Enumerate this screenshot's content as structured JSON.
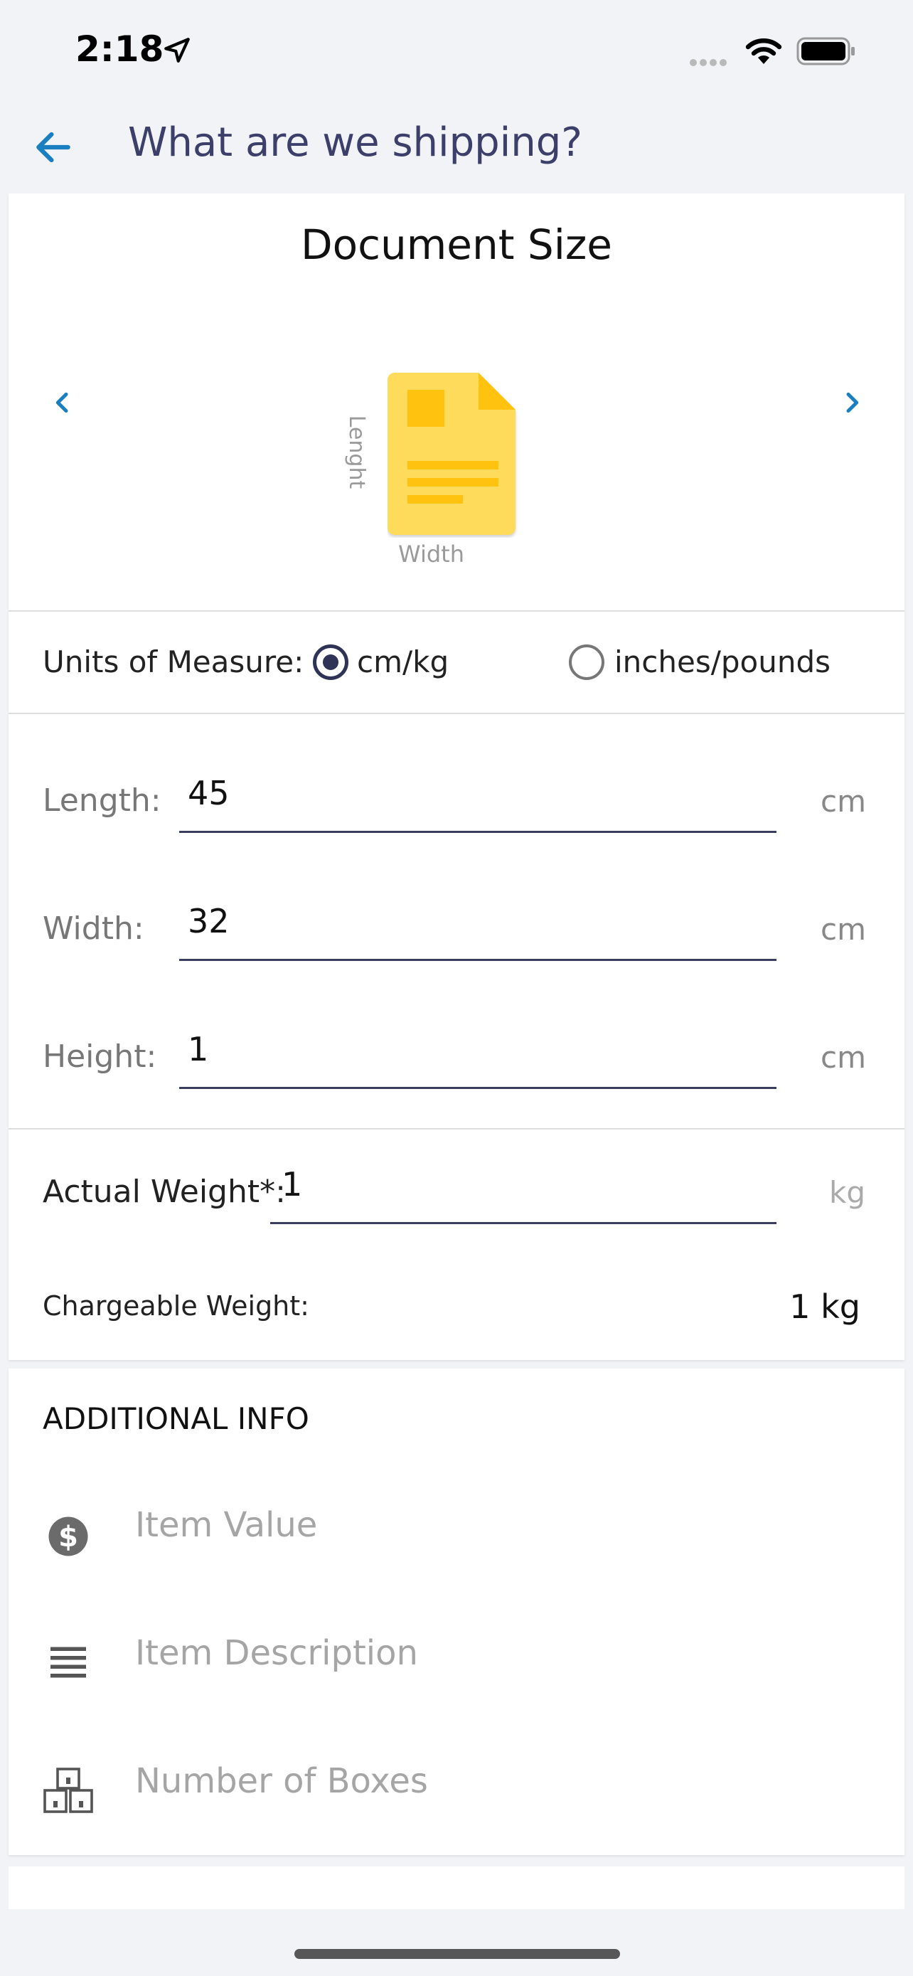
{
  "status_bar": {
    "time": "2:18"
  },
  "header": {
    "title": "What are we shipping?"
  },
  "document": {
    "title": "Document Size",
    "length_axis_label": "Lenght",
    "width_axis_label": "Width"
  },
  "units": {
    "label": "Units of Measure:",
    "options": [
      {
        "label": "cm/kg",
        "selected": true
      },
      {
        "label": "inches/pounds",
        "selected": false
      }
    ]
  },
  "dimensions": {
    "length": {
      "label": "Length:",
      "value": "45",
      "unit": "cm"
    },
    "width": {
      "label": "Width:",
      "value": "32",
      "unit": "cm"
    },
    "height": {
      "label": "Height:",
      "value": "1",
      "unit": "cm"
    }
  },
  "weight": {
    "actual_label": "Actual Weight*:",
    "actual_value": "1",
    "actual_unit": "kg",
    "chargeable_label": "Chargeable Weight:",
    "chargeable_value": "1 kg"
  },
  "additional_info": {
    "title": "ADDITIONAL INFO",
    "item_value_placeholder": "Item Value",
    "item_description_placeholder": "Item Description",
    "boxes_placeholder": "Number of Boxes"
  },
  "colors": {
    "accent": "#1a7fc1",
    "title": "#3b3f6a",
    "doc_yellow": "#ffdb5c",
    "doc_dark_yellow": "#ffc20e"
  }
}
